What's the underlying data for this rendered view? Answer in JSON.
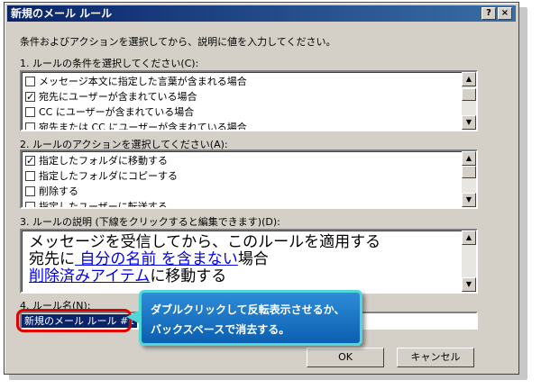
{
  "window": {
    "title": "新規のメール ルール",
    "help_label": "?",
    "close_label": "×"
  },
  "instruction": "条件およびアクションを選択してから、説明に値を入力してください。",
  "conditions": {
    "label": "1. ルールの条件を選択してください(C):",
    "items": [
      {
        "text": "メッセージ本文に指定した言葉が含まれる場合",
        "checked": false
      },
      {
        "text": "宛先にユーザーが含まれている場合",
        "checked": true
      },
      {
        "text": "CC にユーザーが含まれている場合",
        "checked": false
      },
      {
        "text": "宛先または CC にユーザーが含まれている場合",
        "checked": false
      }
    ]
  },
  "actions": {
    "label": "2. ルールのアクションを選択してください(A):",
    "items": [
      {
        "text": "指定したフォルダに移動する",
        "checked": true
      },
      {
        "text": "指定したフォルダにコピーする",
        "checked": false
      },
      {
        "text": "削除する",
        "checked": false
      },
      {
        "text": "指定したユーザーに転送する",
        "checked": false
      }
    ]
  },
  "description": {
    "label": "3. ルールの説明 (下線をクリックすると編集できます)(D):",
    "line1": "メッセージを受信してから、このルールを適用する",
    "line2_prefix": "宛先に",
    "line2_link": " 自分の名前 を含まない",
    "line2_suffix": "場合",
    "line3_link": "削除済みアイテム",
    "line3_suffix": "に移動する"
  },
  "rule_name": {
    "label": "4. ルール名(N):",
    "value": "新規のメール ルール #1"
  },
  "buttons": {
    "ok": "OK",
    "cancel": "キャンセル"
  },
  "callout": {
    "line1": "ダブルクリックして反転表示させるか、",
    "line2": "バックスペースで消去する。"
  },
  "colors": {
    "title_bar": "#0a246a",
    "selection": "#0a246a",
    "highlight_outline": "#e00000",
    "callout_fill": "#1a72c4",
    "callout_border": "#50d8d8",
    "link": "#0000ee"
  }
}
